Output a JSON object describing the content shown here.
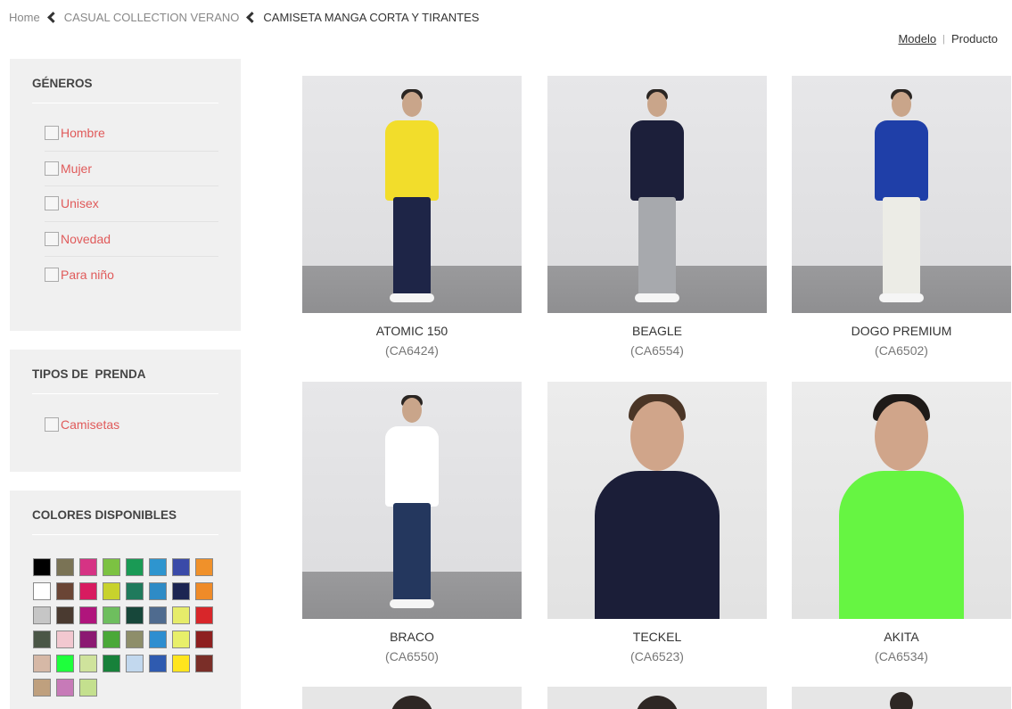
{
  "breadcrumb": {
    "home": "Home",
    "level1": "CASUAL COLLECTION VERANO",
    "current": "CAMISETA MANGA CORTA Y TIRANTES"
  },
  "view_toggle": {
    "modelo": "Modelo",
    "producto": "Producto",
    "divider": "|",
    "active": "Modelo"
  },
  "filters": {
    "generos": {
      "title": "GÉNEROS",
      "items": [
        {
          "label": "Hombre",
          "checked": false
        },
        {
          "label": "Mujer",
          "checked": false
        },
        {
          "label": "Unisex",
          "checked": false
        },
        {
          "label": "Novedad",
          "checked": false
        },
        {
          "label": "Para niño",
          "checked": false
        }
      ]
    },
    "tipos": {
      "title": "TIPOS DE  PRENDA",
      "items": [
        {
          "label": "Camisetas",
          "checked": false
        }
      ]
    },
    "colores": {
      "title": "COLORES DISPONIBLES",
      "swatches": [
        "#000000",
        "#7a7355",
        "#d63384",
        "#7cc242",
        "#1a9a55",
        "#2e95cf",
        "#3a4aa8",
        "#f0912a",
        "#ffffff",
        "#6a4535",
        "#d81b60",
        "#c8d22d",
        "#1f7a5c",
        "#2e8bc6",
        "#1c2552",
        "#ef8b28",
        "#c6c6c6",
        "#4a3a30",
        "#b0157c",
        "#6ebe5e",
        "#17473a",
        "#4f6b8f",
        "#e6ec6a",
        "#d8262a",
        "#4a5646",
        "#f2c8d0",
        "#8c1a72",
        "#4aa838",
        "#8e8e6a",
        "#2e8ed0",
        "#e8ef6a",
        "#8e2020",
        "#d6b8a6",
        "#1eff3c",
        "#cfe39c",
        "#17813a",
        "#c2d8ee",
        "#2f5bb0",
        "#ffe51e",
        "#7a2e28",
        "#bfa07e",
        "#c77ab8",
        "#c4e08e"
      ]
    }
  },
  "products": [
    {
      "name": "ATOMIC 150",
      "ref": "(CA6424)",
      "shirt_color": "#f2dd2b",
      "pants_color": "#1e2547"
    },
    {
      "name": "BEAGLE",
      "ref": "(CA6554)",
      "shirt_color": "#1c1f3a",
      "pants_color": "#a7a9ad"
    },
    {
      "name": "DOGO PREMIUM",
      "ref": "(CA6502)",
      "shirt_color": "#1f3fa8",
      "pants_color": "#ecece6"
    },
    {
      "name": "BRACO",
      "ref": "(CA6550)",
      "shirt_color": "#ffffff",
      "pants_color": "#24375e"
    },
    {
      "name": "TECKEL",
      "ref": "(CA6523)",
      "shirt_color": "#1b1e38",
      "pants_color": "#e8e8e8"
    },
    {
      "name": "AKITA",
      "ref": "(CA6534)",
      "shirt_color": "#66f542",
      "pants_color": "#4a6890"
    }
  ]
}
